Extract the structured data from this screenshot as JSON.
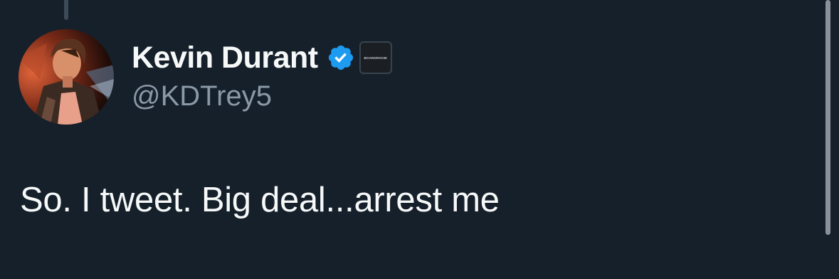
{
  "tweet": {
    "author": {
      "display_name": "Kevin Durant",
      "handle": "@KDTrey5",
      "verified": true,
      "affiliate_badge": "BOARDROOM"
    },
    "text": "So. I tweet. Big deal...arrest me"
  },
  "colors": {
    "background": "#15202b",
    "primary_text": "#f7f9f9",
    "secondary_text": "#8b98a5",
    "verified_blue": "#1d9bf0"
  },
  "icons": {
    "verified": "verified-badge-icon",
    "affiliate": "boardroom-logo-icon"
  }
}
